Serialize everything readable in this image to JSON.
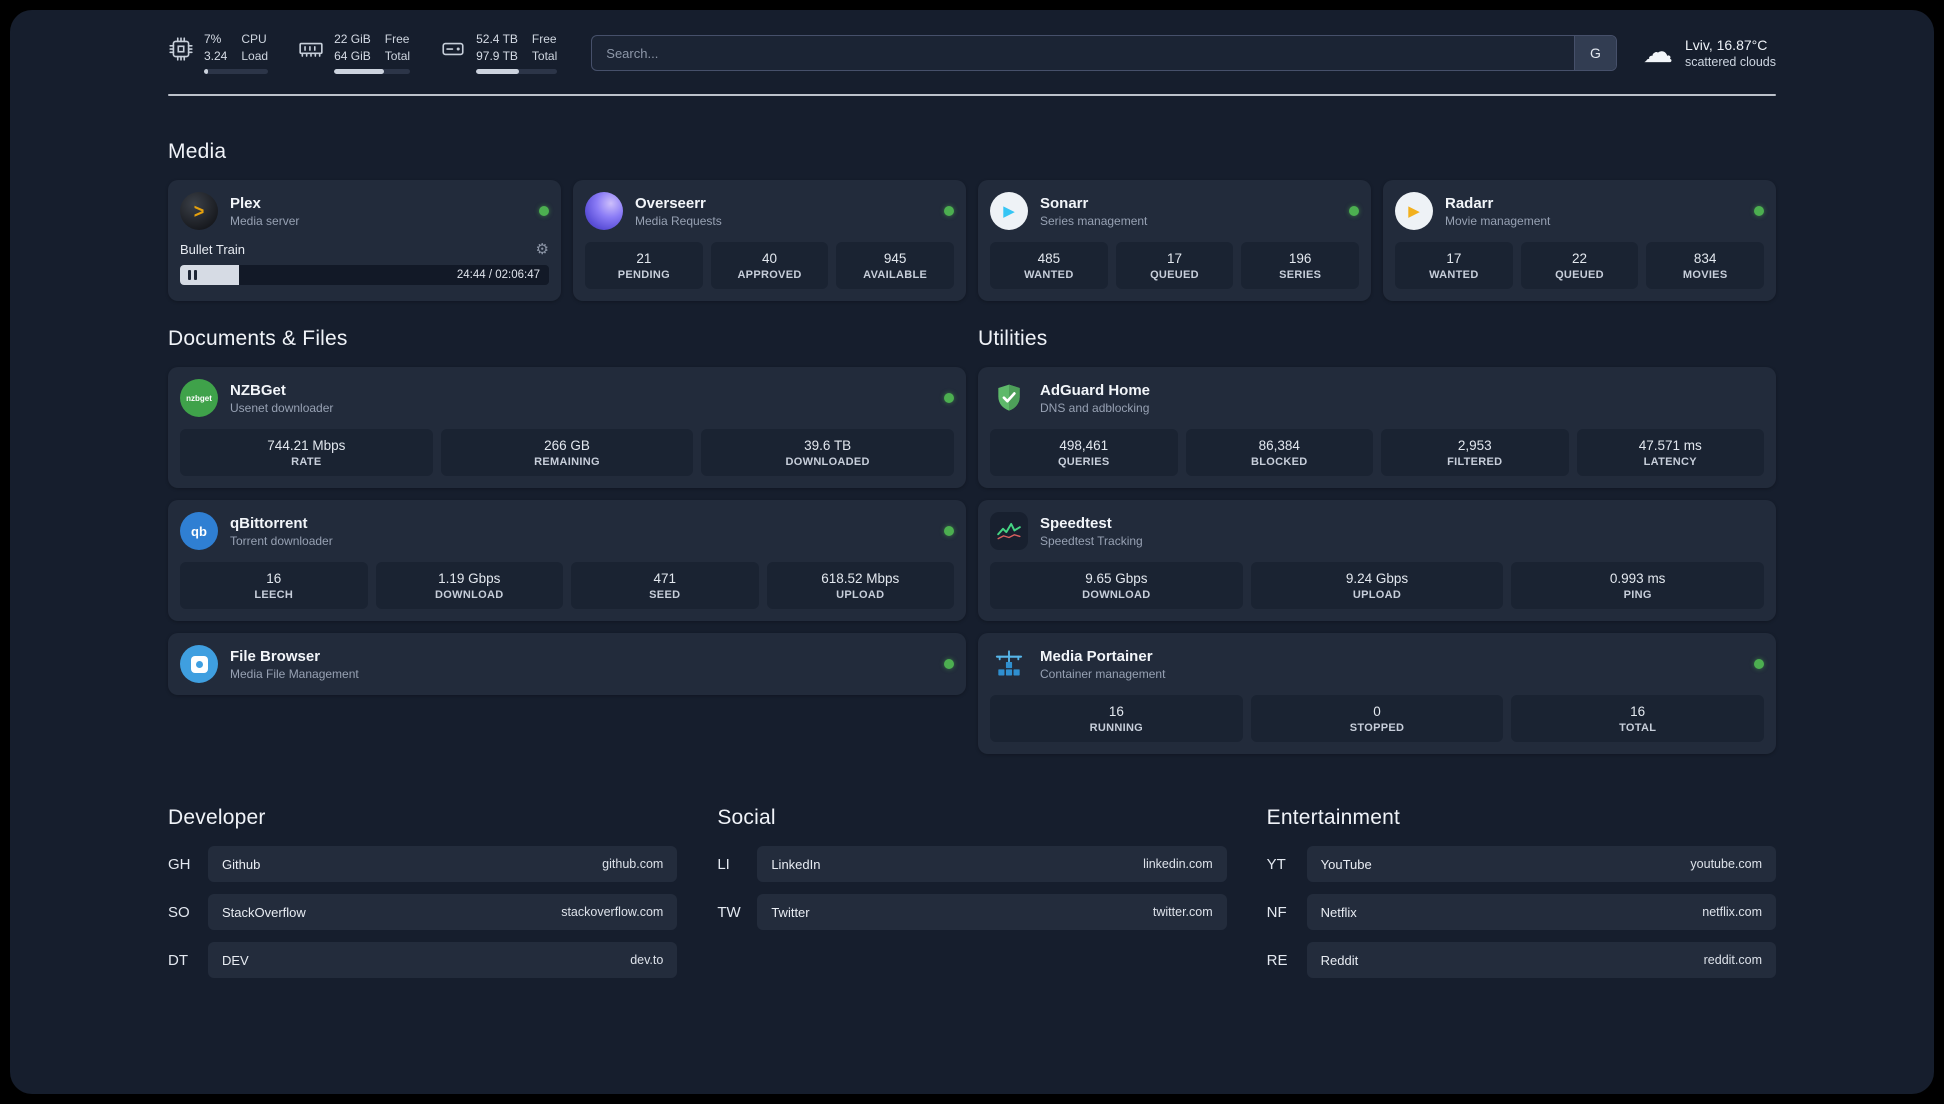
{
  "colors": {
    "background": "#161e2d",
    "card": "#222b3b",
    "tile": "#1a2332",
    "status_online": "#4caf50",
    "plex_gold": "#e5a00d",
    "overseerr_purple": "#8b7cf6",
    "sonarr_blue": "#35c5f4",
    "radarr_yellow": "#f2b01e",
    "nzbget_green": "#3fa24a",
    "qbittorrent_blue": "#2f7fd3",
    "filebrowser_blue": "#3f9fe0",
    "adguard_green": "#5eb96a",
    "speedtest_green": "#45d483",
    "portainer_blue": "#3aa0e0"
  },
  "header": {
    "cpu": {
      "value_top": "7%",
      "value_bottom": "3.24",
      "label_top": "CPU",
      "label_bottom": "Load",
      "progress": 7
    },
    "ram": {
      "value_top": "22 GiB",
      "value_bottom": "64 GiB",
      "label_top": "Free",
      "label_bottom": "Total",
      "progress": 66
    },
    "disk": {
      "value_top": "52.4 TB",
      "value_bottom": "97.9 TB",
      "label_top": "Free",
      "label_bottom": "Total",
      "progress": 53
    },
    "search": {
      "placeholder": "Search...",
      "button_label": "G"
    },
    "weather": {
      "location": "Lviv, 16.87°C",
      "condition": "scattered clouds"
    }
  },
  "icon_text": {
    "nzbget": "nzbget",
    "qbittorrent": "qb"
  },
  "media": {
    "title": "Media",
    "plex": {
      "name": "Plex",
      "subtitle": "Media server",
      "now_playing": "Bullet Train",
      "time": "24:44 / 02:06:47",
      "progress": 16
    },
    "overseerr": {
      "name": "Overseerr",
      "subtitle": "Media Requests",
      "stats": [
        {
          "value": "21",
          "label": "PENDING"
        },
        {
          "value": "40",
          "label": "APPROVED"
        },
        {
          "value": "945",
          "label": "AVAILABLE"
        }
      ]
    },
    "sonarr": {
      "name": "Sonarr",
      "subtitle": "Series management",
      "stats": [
        {
          "value": "485",
          "label": "WANTED"
        },
        {
          "value": "17",
          "label": "QUEUED"
        },
        {
          "value": "196",
          "label": "SERIES"
        }
      ]
    },
    "radarr": {
      "name": "Radarr",
      "subtitle": "Movie management",
      "stats": [
        {
          "value": "17",
          "label": "WANTED"
        },
        {
          "value": "22",
          "label": "QUEUED"
        },
        {
          "value": "834",
          "label": "MOVIES"
        }
      ]
    }
  },
  "documents": {
    "title": "Documents & Files",
    "nzbget": {
      "name": "NZBGet",
      "subtitle": "Usenet downloader",
      "stats": [
        {
          "value": "744.21 Mbps",
          "label": "RATE"
        },
        {
          "value": "266 GB",
          "label": "REMAINING"
        },
        {
          "value": "39.6 TB",
          "label": "DOWNLOADED"
        }
      ]
    },
    "qbittorrent": {
      "name": "qBittorrent",
      "subtitle": "Torrent downloader",
      "stats": [
        {
          "value": "16",
          "label": "LEECH"
        },
        {
          "value": "1.19 Gbps",
          "label": "DOWNLOAD"
        },
        {
          "value": "471",
          "label": "SEED"
        },
        {
          "value": "618.52 Mbps",
          "label": "UPLOAD"
        }
      ]
    },
    "filebrowser": {
      "name": "File Browser",
      "subtitle": "Media File Management"
    }
  },
  "utilities": {
    "title": "Utilities",
    "adguard": {
      "name": "AdGuard Home",
      "subtitle": "DNS and adblocking",
      "stats": [
        {
          "value": "498,461",
          "label": "QUERIES"
        },
        {
          "value": "86,384",
          "label": "BLOCKED"
        },
        {
          "value": "2,953",
          "label": "FILTERED"
        },
        {
          "value": "47.571 ms",
          "label": "LATENCY"
        }
      ]
    },
    "speedtest": {
      "name": "Speedtest",
      "subtitle": "Speedtest Tracking",
      "stats": [
        {
          "value": "9.65 Gbps",
          "label": "DOWNLOAD"
        },
        {
          "value": "9.24 Gbps",
          "label": "UPLOAD"
        },
        {
          "value": "0.993 ms",
          "label": "PING"
        }
      ]
    },
    "portainer": {
      "name": "Media Portainer",
      "subtitle": "Container management",
      "stats": [
        {
          "value": "16",
          "label": "RUNNING"
        },
        {
          "value": "0",
          "label": "STOPPED"
        },
        {
          "value": "16",
          "label": "TOTAL"
        }
      ]
    }
  },
  "bookmarks": [
    {
      "title": "Developer",
      "items": [
        {
          "abbr": "GH",
          "name": "Github",
          "url": "github.com"
        },
        {
          "abbr": "SO",
          "name": "StackOverflow",
          "url": "stackoverflow.com"
        },
        {
          "abbr": "DT",
          "name": "DEV",
          "url": "dev.to"
        }
      ]
    },
    {
      "title": "Social",
      "items": [
        {
          "abbr": "LI",
          "name": "LinkedIn",
          "url": "linkedin.com"
        },
        {
          "abbr": "TW",
          "name": "Twitter",
          "url": "twitter.com"
        }
      ]
    },
    {
      "title": "Entertainment",
      "items": [
        {
          "abbr": "YT",
          "name": "YouTube",
          "url": "youtube.com"
        },
        {
          "abbr": "NF",
          "name": "Netflix",
          "url": "netflix.com"
        },
        {
          "abbr": "RE",
          "name": "Reddit",
          "url": "reddit.com"
        }
      ]
    }
  ]
}
